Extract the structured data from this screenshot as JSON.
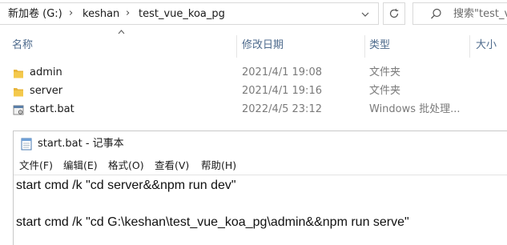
{
  "explorer": {
    "breadcrumb": [
      "新加卷 (G:)",
      "keshan",
      "test_vue_koa_pg"
    ],
    "breadcrumb_sep": "›",
    "search_placeholder": "搜索\"test_v",
    "columns": {
      "name": "名称",
      "modified": "修改日期",
      "type": "类型",
      "size": "大小"
    },
    "files": [
      {
        "name": "admin",
        "modified": "2021/4/1 19:08",
        "type": "文件夹",
        "icon": "folder-icon"
      },
      {
        "name": "server",
        "modified": "2021/4/1 19:16",
        "type": "文件夹",
        "icon": "folder-icon"
      },
      {
        "name": "start.bat",
        "modified": "2022/4/5 23:12",
        "type": "Windows 批处理...",
        "icon": "batch-file-icon"
      }
    ],
    "colors": {
      "folder": "#e8b53a",
      "header_text": "#4d6a8c"
    }
  },
  "notepad": {
    "title": "start.bat - 记事本",
    "menu": [
      "文件(F)",
      "编辑(E)",
      "格式(O)",
      "查看(V)",
      "帮助(H)"
    ],
    "lines": [
      "start cmd /k \"cd server&&npm run dev\"",
      "",
      "start cmd /k \"cd G:\\keshan\\test_vue_koa_pg\\admin&&npm run serve\""
    ]
  }
}
